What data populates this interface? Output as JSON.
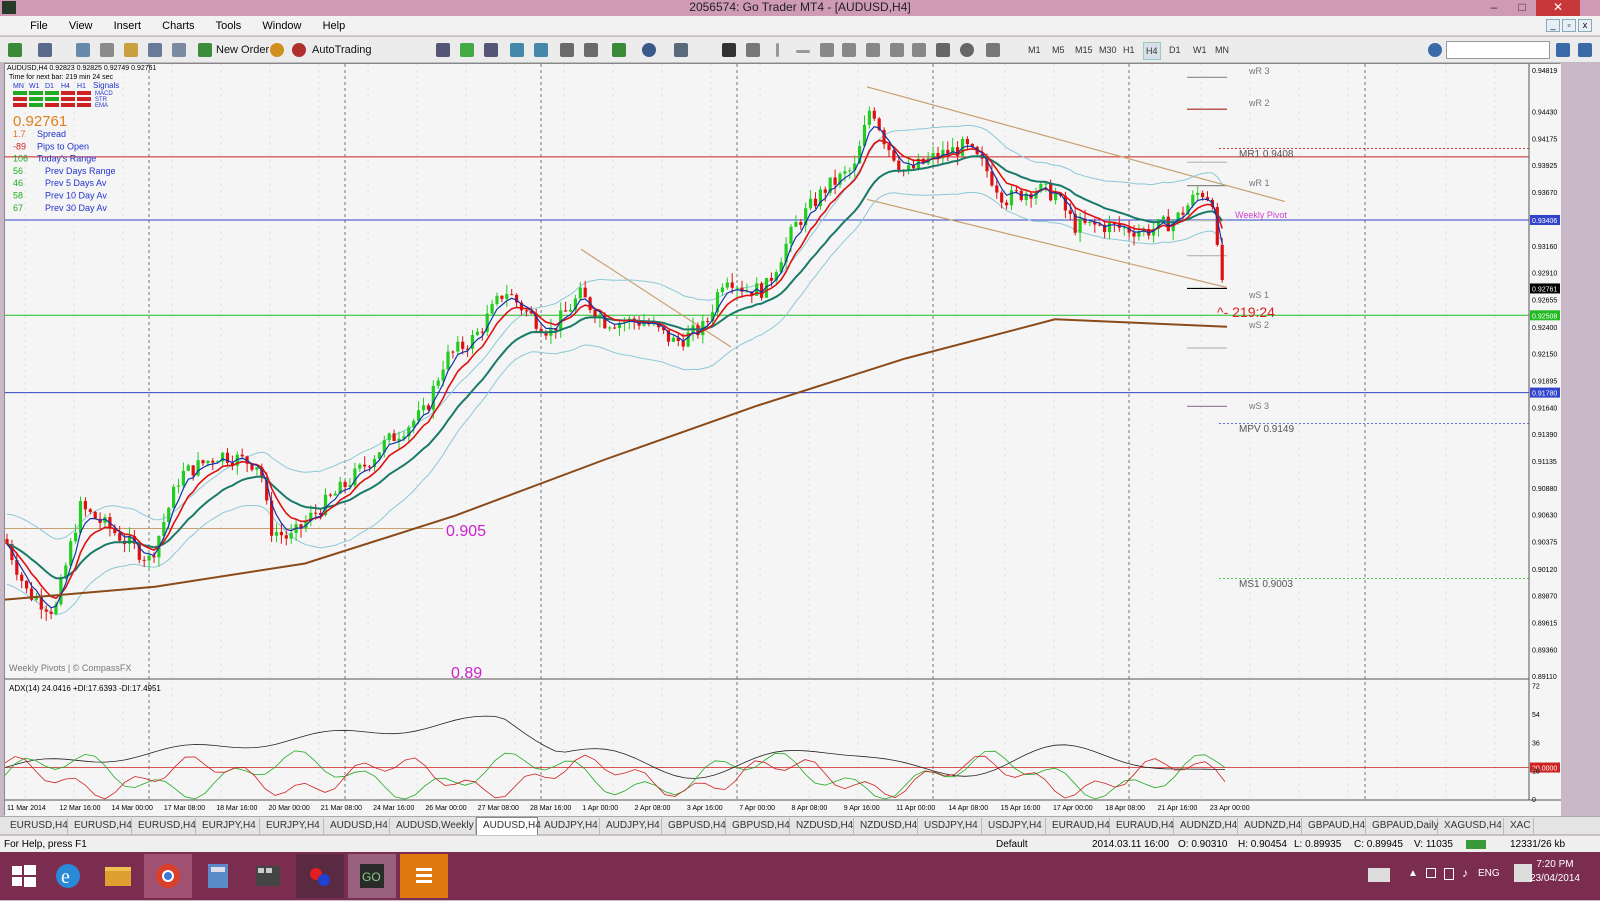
{
  "window": {
    "title": "2056574: Go Trader MT4 - [AUDUSD,H4]",
    "min": "–",
    "max": "□",
    "close": "✕"
  },
  "menu": [
    "File",
    "View",
    "Insert",
    "Charts",
    "Tools",
    "Window",
    "Help"
  ],
  "toolbar": {
    "new_order": "New Order",
    "autotrading": "AutoTrading",
    "timeframes": [
      "M1",
      "M5",
      "M15",
      "M30",
      "H1",
      "H4",
      "D1",
      "W1",
      "MN"
    ],
    "active_timeframe": "H4"
  },
  "chart": {
    "header": "AUDUSD,H4  0.92823 0.92825 0.92749 0.92761",
    "info_panel": {
      "next_bar": "Time for next bar: 219 min 24 sec",
      "periods": [
        "MN",
        "W1",
        "D1",
        "H4",
        "H1"
      ],
      "signals_title": "Signals",
      "signals": [
        "MACD",
        "STR",
        "EMA"
      ],
      "price": "0.92761",
      "rows": [
        {
          "value": "1.7",
          "label": "Spread",
          "color": "#e07020"
        },
        {
          "value": "-89",
          "label": "Pips to Open",
          "color": "#d02020"
        },
        {
          "value": "106",
          "label": "Today's Range",
          "color": "#22aa22"
        },
        {
          "value": "56",
          "label": "Prev Days Range",
          "color": "#22aa22"
        },
        {
          "value": "46",
          "label": "Prev 5 Days Av",
          "color": "#22aa22"
        },
        {
          "value": "58",
          "label": "Prev 10 Day Av",
          "color": "#22aa22"
        },
        {
          "value": "67",
          "label": "Prev 30 Day Av",
          "color": "#22aa22"
        }
      ]
    },
    "price_axis": [
      "0.94819",
      "0.94430",
      "0.94175",
      "0.93925",
      "0.93670",
      "0.93406",
      "0.93160",
      "0.92910",
      "0.92761",
      "0.92655",
      "0.92508",
      "0.92400",
      "0.92150",
      "0.91895",
      "0.91780",
      "0.91640",
      "0.91390",
      "0.91135",
      "0.90880",
      "0.90630",
      "0.90375",
      "0.90120",
      "0.89870",
      "0.89615",
      "0.89360",
      "0.89110"
    ],
    "highlight_prices": {
      "0.94000": "#cc2222",
      "0.93406": "#3344cc",
      "0.92761": "#000000",
      "0.92508": "#22bb22",
      "0.91780": "#3344cc"
    },
    "pivots": {
      "wr3": "wR 3",
      "wr2": "wR 2",
      "mr1": "MR1  0.9408",
      "wr1": "wR 1",
      "weekly_pivot": "Weekly Pivot",
      "ws1": "wS 1",
      "countdown": "^- 219:24",
      "ws2": "wS 2",
      "ws3": "wS 3",
      "mpv": "MPV  0.9149",
      "ms1": "MS1  0.9003"
    },
    "annotations": {
      "level_0905": "0.905",
      "level_089": "0.89",
      "credit": "Weekly Pivots | © CompassFX"
    },
    "adx": {
      "header": "ADX(14) 24.0416 +DI:17.6393 -DI:17.4951",
      "axis": [
        "72",
        "54",
        "36",
        "20.0000",
        "18",
        "0"
      ]
    },
    "time_axis": [
      "11 Mar 2014",
      "12 Mar 16:00",
      "14 Mar 00:00",
      "17 Mar 08:00",
      "18 Mar 16:00",
      "20 Mar 00:00",
      "21 Mar 08:00",
      "24 Mar 16:00",
      "26 Mar 00:00",
      "27 Mar 08:00",
      "28 Mar 16:00",
      "1 Apr 00:00",
      "2 Apr 08:00",
      "3 Apr 16:00",
      "7 Apr 00:00",
      "8 Apr 08:00",
      "9 Apr 16:00",
      "11 Apr 00:00",
      "14 Apr 08:00",
      "15 Apr 16:00",
      "17 Apr 00:00",
      "18 Apr 08:00",
      "21 Apr 16:00",
      "23 Apr 00:00"
    ]
  },
  "tabs": [
    "EURUSD,H4",
    "EURUSD,H4",
    "EURUSD,H4",
    "EURJPY,H4",
    "EURJPY,H4",
    "AUDUSD,H4",
    "AUDUSD,Weekly",
    "AUDUSD,H4",
    "AUDJPY,H4",
    "AUDJPY,H4",
    "GBPUSD,H4",
    "GBPUSD,H4",
    "NZDUSD,H4",
    "NZDUSD,H4",
    "USDJPY,H4",
    "USDJPY,H4",
    "EURAUD,H4",
    "EURAUD,H4",
    "AUDNZD,H4",
    "AUDNZD,H4",
    "GBPAUD,H4",
    "GBPAUD,Daily",
    "XAGUSD,H4",
    "XAC"
  ],
  "active_tab": 7,
  "status": {
    "help": "For Help, press F1",
    "profile": "Default",
    "time": "2014.03.11 16:00",
    "open": "O: 0.90310",
    "high": "H: 0.90454",
    "low": "L: 0.89935",
    "close": "C: 0.89945",
    "volume": "V: 11035",
    "traffic": "12331/26 kb"
  },
  "taskbar": {
    "time": "7:20 PM",
    "date": "23/04/2014",
    "lang": "ENG"
  }
}
